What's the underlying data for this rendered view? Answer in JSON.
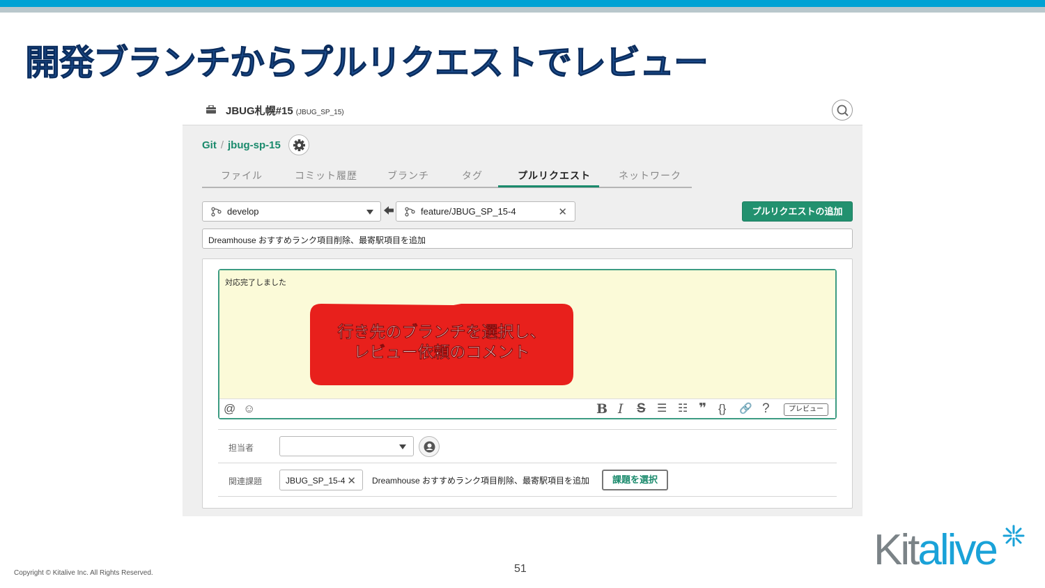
{
  "slide": {
    "title": "開発ブランチからプルリクエストでレビュー",
    "page_number": "51",
    "copyright": "Copyright © Kitalive Inc. All Rights Reserved.",
    "logo": {
      "text_a": "Kit",
      "text_b": "alive",
      "icon": "asterisk-star-icon"
    }
  },
  "app": {
    "project_name": "JBUG札幌#15",
    "project_key": "(JBUG_SP_15)",
    "breadcrumb": {
      "root": "Git",
      "separator": "/",
      "repo": "jbug-sp-15"
    },
    "tabs": [
      {
        "label": "ファイル",
        "active": false
      },
      {
        "label": "コミット履歴",
        "active": false
      },
      {
        "label": "ブランチ",
        "active": false
      },
      {
        "label": "タグ",
        "active": false
      },
      {
        "label": "プルリクエスト",
        "active": true
      },
      {
        "label": "ネットワーク",
        "active": false
      }
    ],
    "base_branch": "develop",
    "compare_branch": "feature/JBUG_SP_15-4",
    "add_pr_button": "プルリクエストの追加",
    "pr_title": "Dreamhouse おすすめランク項目削除、最寄駅項目を追加",
    "description": "対応完了しました",
    "editor_toolbar": {
      "left": [
        "@",
        "☺"
      ],
      "right": [
        "B",
        "I",
        "S",
        "☰",
        "☷",
        "❞",
        "{}",
        "🔗",
        "?"
      ],
      "preview_label": "プレビュー"
    },
    "assignee_label": "担当者",
    "assignee_value": "",
    "related_issue_label": "関連課題",
    "related_issue_key": "JBUG_SP_15-4",
    "related_issue_title": "Dreamhouse おすすめランク項目削除、最寄駅項目を追加",
    "select_issue_button": "課題を選択"
  },
  "callout": {
    "line1": "行き先のブランチを選択し、",
    "line2": "レビュー依頼のコメント",
    "color": "#e8201c"
  },
  "colors": {
    "accent": "#1a8a6c",
    "title": "#1d4f91",
    "topbar": "#00a2d4"
  }
}
